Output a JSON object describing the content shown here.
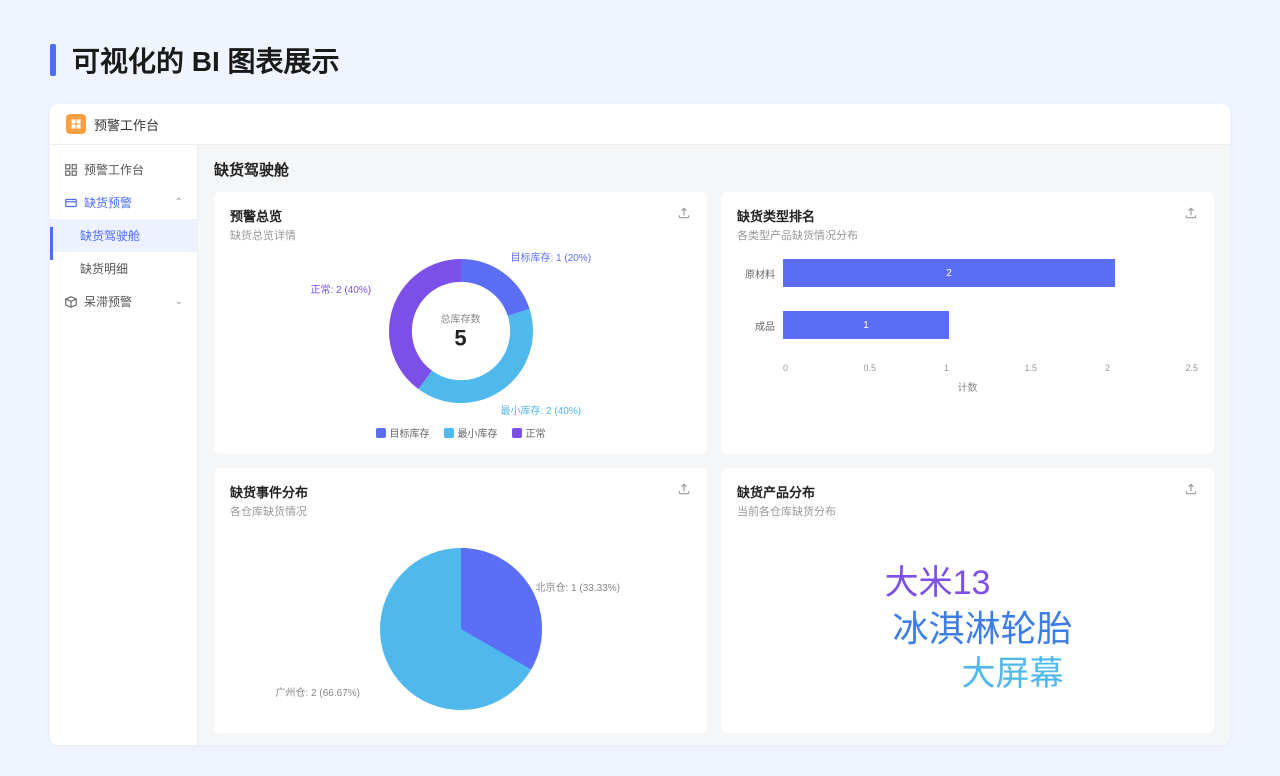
{
  "headline": "可视化的 BI 图表展示",
  "app": {
    "title": "预警工作台"
  },
  "sidebar": {
    "items": [
      {
        "label": "预警工作台",
        "icon": "dashboard"
      },
      {
        "label": "缺货预警",
        "icon": "stock",
        "expanded": true,
        "children": [
          {
            "label": "缺货驾驶舱",
            "active": true
          },
          {
            "label": "缺货明细"
          }
        ]
      },
      {
        "label": "呆滞预警",
        "icon": "box",
        "expanded": false
      }
    ]
  },
  "main": {
    "title": "缺货驾驶舱"
  },
  "cards": {
    "overview": {
      "title": "预警总览",
      "subtitle": "缺货总览详情",
      "center_label": "总库存数",
      "center_value": "5",
      "legend": [
        {
          "label": "目标库存",
          "color": "#5b6ef5"
        },
        {
          "label": "最小库存",
          "color": "#4fb8ec"
        },
        {
          "label": "正常",
          "color": "#7b4fe8"
        }
      ],
      "slice_labels": {
        "a": "目标库存: 1 (20%)",
        "b": "最小库存: 2 (40%)",
        "c": "正常: 2 (40%)"
      }
    },
    "ranking": {
      "title": "缺货类型排名",
      "subtitle": "各类型产品缺货情况分布",
      "axis_label": "计数",
      "ticks": [
        "0",
        "0.5",
        "1",
        "1.5",
        "2",
        "2.5"
      ]
    },
    "events": {
      "title": "缺货事件分布",
      "subtitle": "各仓库缺货情况",
      "slice_labels": {
        "a": "北京仓: 1 (33.33%)",
        "b": "广州仓: 2 (66.67%)"
      }
    },
    "products": {
      "title": "缺货产品分布",
      "subtitle": "当前各仓库缺货分布",
      "words": [
        {
          "text": "大米13",
          "color": "#7b4fe8",
          "size": 34
        },
        {
          "text": "冰淇淋轮胎",
          "color": "#3d7de8",
          "size": 36
        },
        {
          "text": "大屏幕",
          "color": "#4fb8ec",
          "size": 34
        }
      ]
    }
  },
  "chart_data": [
    {
      "type": "pie",
      "title": "预警总览",
      "subtitle": "缺货总览详情",
      "center_label": "总库存数",
      "center_value": 5,
      "series": [
        {
          "name": "目标库存",
          "value": 1,
          "percent": 20,
          "color": "#5b6ef5"
        },
        {
          "name": "最小库存",
          "value": 2,
          "percent": 40,
          "color": "#4fb8ec"
        },
        {
          "name": "正常",
          "value": 2,
          "percent": 40,
          "color": "#7b4fe8"
        }
      ],
      "donut": true
    },
    {
      "type": "bar",
      "title": "缺货类型排名",
      "subtitle": "各类型产品缺货情况分布",
      "orientation": "horizontal",
      "xlabel": "计数",
      "xlim": [
        0,
        2.5
      ],
      "categories": [
        "原材料",
        "成品"
      ],
      "values": [
        2,
        1
      ],
      "color": "#5b6ef5"
    },
    {
      "type": "pie",
      "title": "缺货事件分布",
      "subtitle": "各仓库缺货情况",
      "series": [
        {
          "name": "北京仓",
          "value": 1,
          "percent": 33.33,
          "color": "#5b6ef5"
        },
        {
          "name": "广州仓",
          "value": 2,
          "percent": 66.67,
          "color": "#4fb8ec"
        }
      ],
      "donut": false
    },
    {
      "type": "wordcloud",
      "title": "缺货产品分布",
      "subtitle": "当前各仓库缺货分布",
      "words": [
        {
          "text": "大米13",
          "weight": 3,
          "color": "#7b4fe8"
        },
        {
          "text": "冰淇淋轮胎",
          "weight": 4,
          "color": "#3d7de8"
        },
        {
          "text": "大屏幕",
          "weight": 3,
          "color": "#4fb8ec"
        }
      ]
    }
  ]
}
